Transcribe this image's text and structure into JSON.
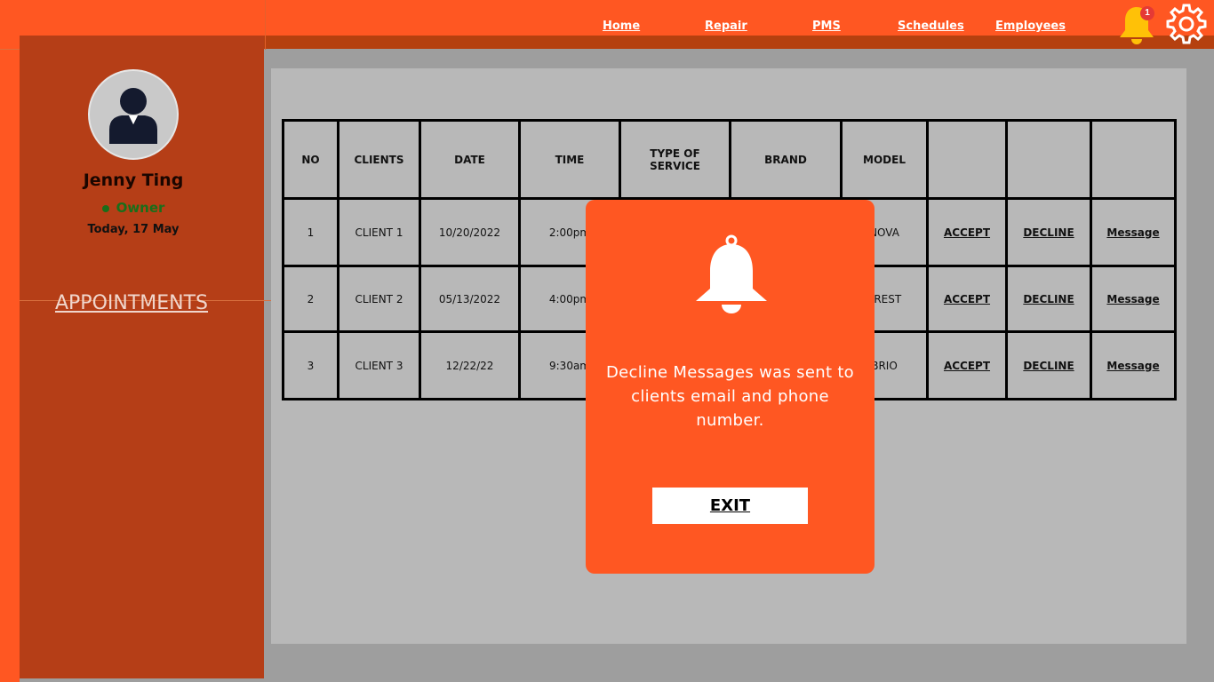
{
  "nav": {
    "home": "Home",
    "repair": "Repair",
    "pms": "PMS",
    "schedules": "Schedules",
    "employees": "Employees"
  },
  "notifications": {
    "count": "1",
    "icon": "bell-icon",
    "color": "#ffc107"
  },
  "settings": {
    "icon": "gear-icon"
  },
  "profile": {
    "name": "Jenny Ting",
    "role": "Owner",
    "date": "Today, 17 May"
  },
  "sidebar": {
    "appointments": "APPOINTMENTS"
  },
  "table": {
    "headers": [
      "NO",
      "CLIENTS",
      "DATE",
      "TIME",
      "TYPE OF SERVICE",
      "BRAND",
      "MODEL",
      "",
      "",
      ""
    ],
    "rows": [
      {
        "no": "1",
        "client": "CLIENT 1",
        "date": "10/20/2022",
        "time": "2:00pm",
        "model": "NOVA",
        "accept": "ACCEPT",
        "decline": "DECLINE",
        "message": "Message"
      },
      {
        "no": "2",
        "client": "CLIENT 2",
        "date": "05/13/2022",
        "time": "4:00pm",
        "model": "EREST",
        "accept": "ACCEPT",
        "decline": "DECLINE",
        "message": "Message"
      },
      {
        "no": "3",
        "client": "CLIENT 3",
        "date": "12/22/22",
        "time": "9:30am",
        "model": "BRIO",
        "accept": "ACCEPT",
        "decline": "DECLINE",
        "message": "Message"
      }
    ]
  },
  "modal": {
    "message": "Decline Messages was sent to clients email and phone number.",
    "exit": "EXIT",
    "icon": "bell-icon"
  },
  "colors": {
    "brand": "#ff5722",
    "sidebar": "#b53e17",
    "owner_status": "#1a6e1a",
    "notification_badge": "#e53935"
  }
}
